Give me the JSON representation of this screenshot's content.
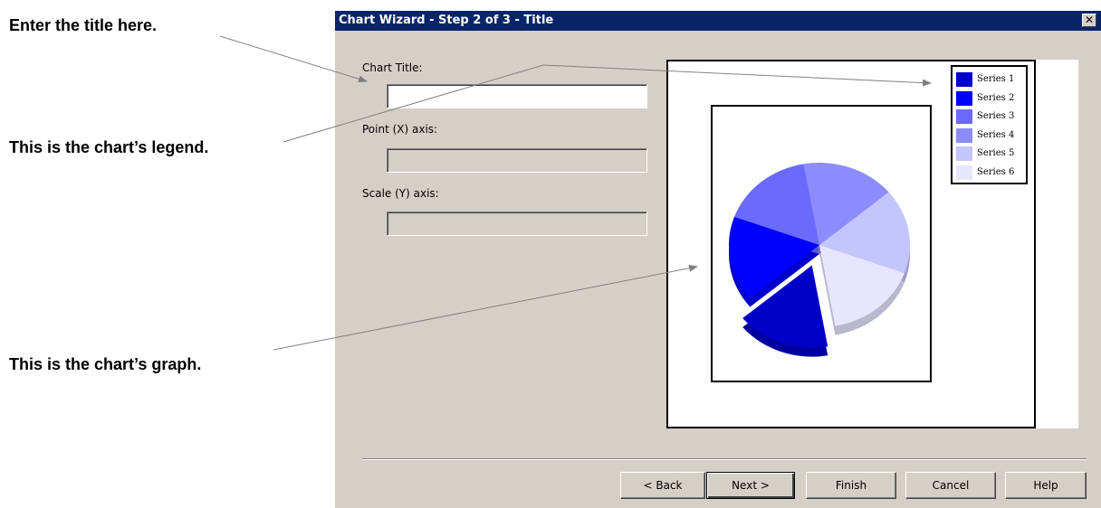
{
  "annotations": {
    "title_callout": "Enter the title here.",
    "legend_callout": "This is the chart’s legend.",
    "graph_callout": "This is the chart’s graph."
  },
  "dialog": {
    "title": "Chart Wizard - Step 2 of 3 - Title",
    "close_label": "✕",
    "fields": {
      "chart_title": {
        "label": "Chart Title:",
        "value": "",
        "enabled": true
      },
      "x_axis": {
        "label": "Point (X) axis:",
        "value": "",
        "enabled": false
      },
      "y_axis": {
        "label": "Scale (Y) axis:",
        "value": "",
        "enabled": false
      }
    },
    "buttons": {
      "back": "< Back",
      "next": "Next >",
      "finish": "Finish",
      "cancel": "Cancel",
      "help": "Help"
    }
  },
  "chart_data": {
    "type": "pie",
    "legend_position": "top-right",
    "legend": [
      {
        "name": "Series 1",
        "color": "#0000c8"
      },
      {
        "name": "Series 2",
        "color": "#0000ff"
      },
      {
        "name": "Series 3",
        "color": "#6a6aff"
      },
      {
        "name": "Series 4",
        "color": "#8c8cff"
      },
      {
        "name": "Series 5",
        "color": "#c4c4ff"
      },
      {
        "name": "Series 6",
        "color": "#e6e6ff"
      }
    ],
    "slices": [
      {
        "series": "Series 1",
        "color": "#0000c8",
        "value": 16.7,
        "exploded": true
      },
      {
        "series": "Series 2",
        "color": "#0000ff",
        "value": 16.7,
        "exploded": false
      },
      {
        "series": "Series 3",
        "color": "#6a6aff",
        "value": 16.7,
        "exploded": false
      },
      {
        "series": "Series 4",
        "color": "#8c8cff",
        "value": 16.7,
        "exploded": false
      },
      {
        "series": "Series 5",
        "color": "#c4c4ff",
        "value": 16.7,
        "exploded": false
      },
      {
        "series": "Series 6",
        "color": "#e6e6ff",
        "value": 16.7,
        "exploded": false
      }
    ]
  }
}
